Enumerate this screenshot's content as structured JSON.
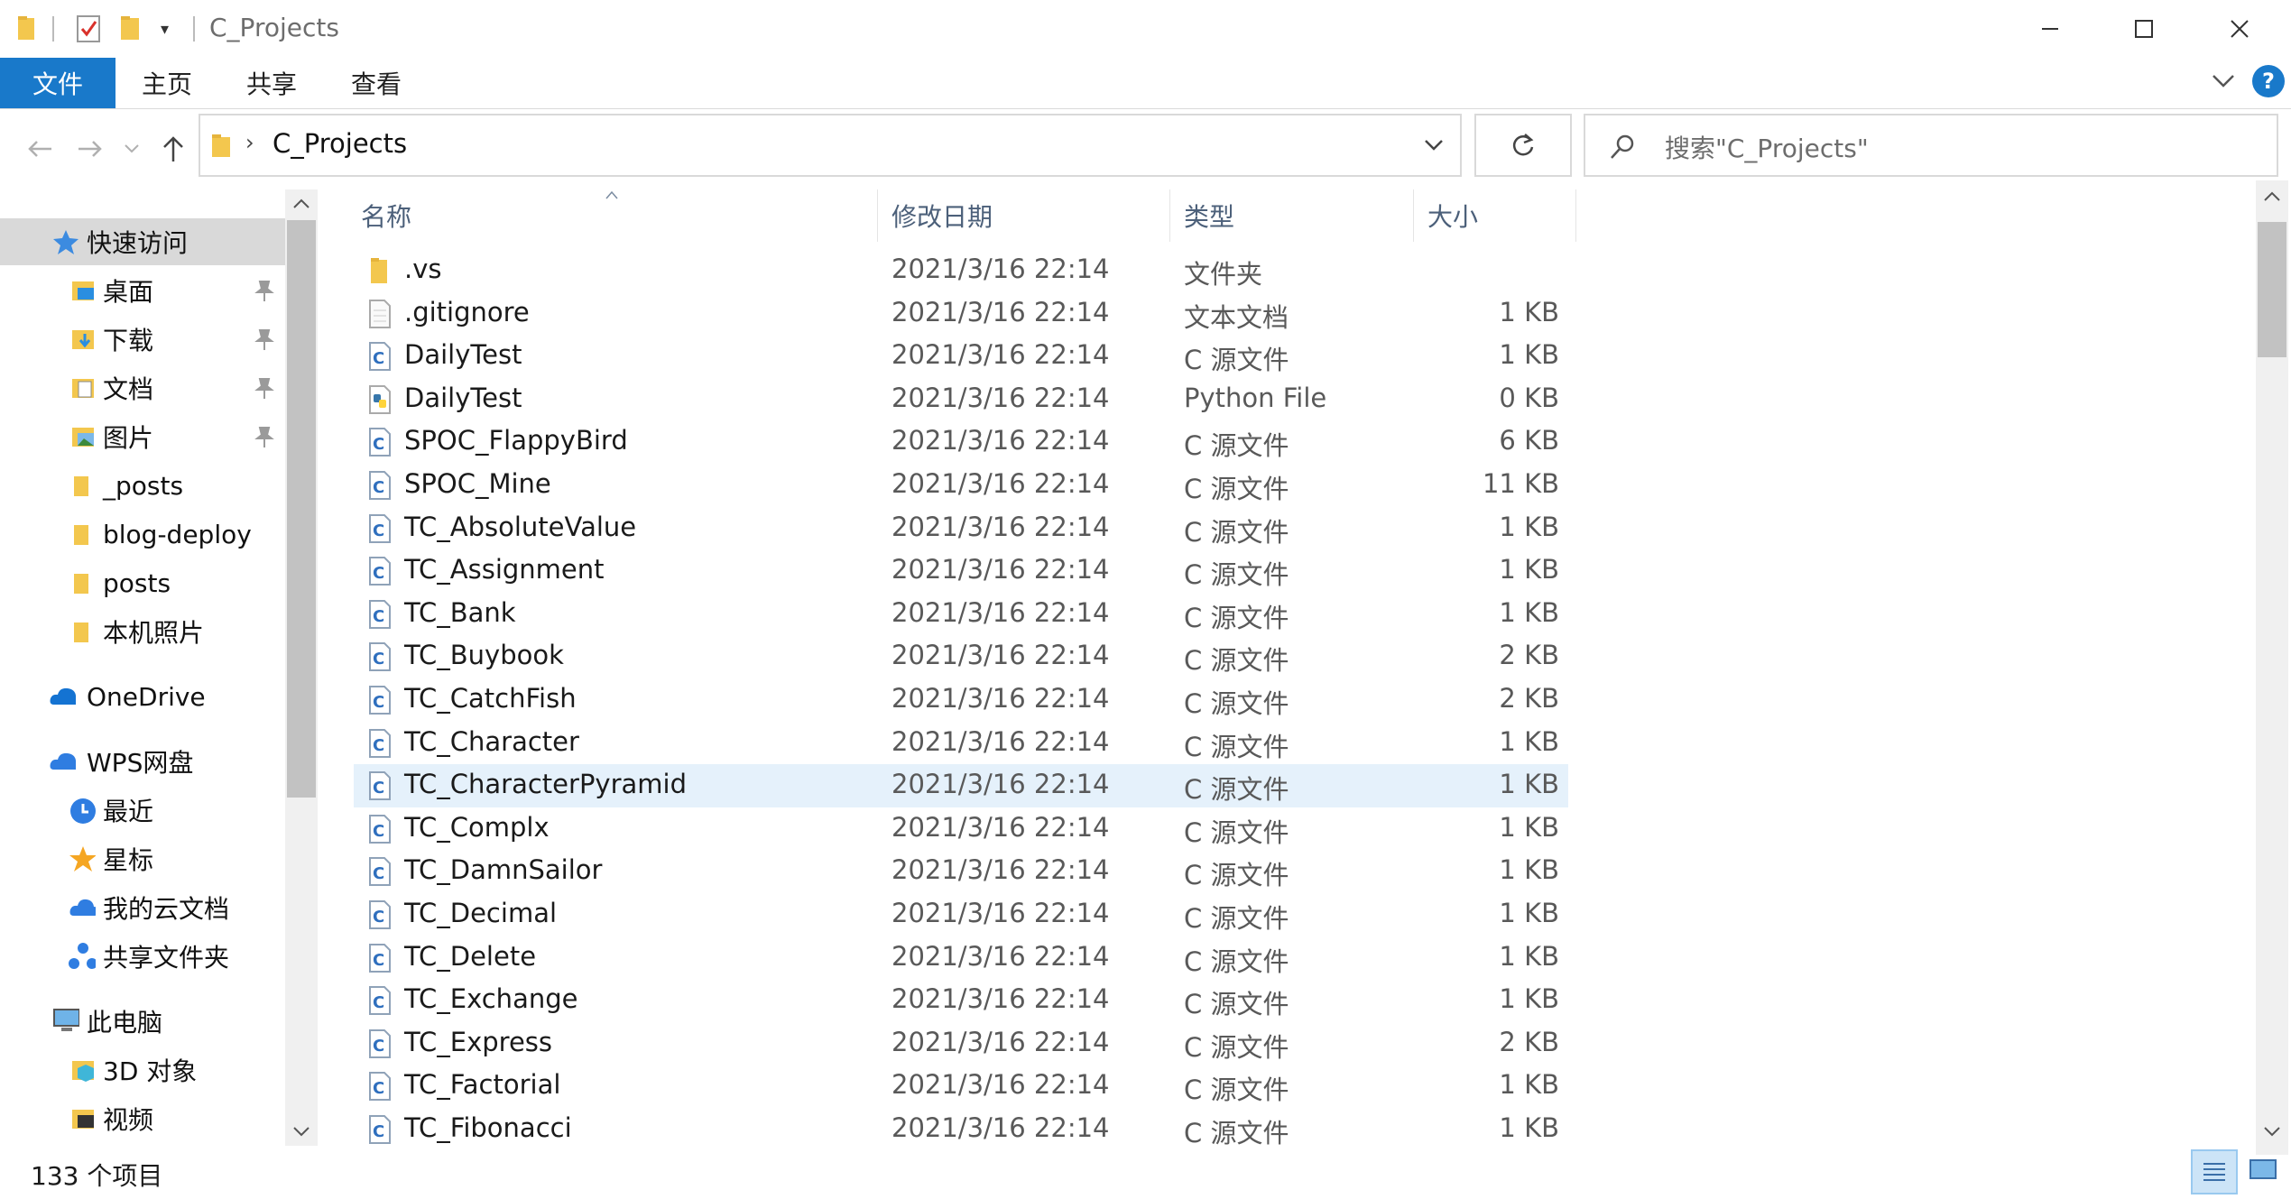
{
  "window": {
    "title": "C_Projects",
    "controls": [
      "minimize",
      "maximize",
      "close"
    ]
  },
  "ribbon": {
    "tabs": [
      "文件",
      "主页",
      "共享",
      "查看"
    ]
  },
  "address": {
    "current_folder": "C_Projects",
    "search_placeholder": "搜索\"C_Projects\""
  },
  "nav": {
    "quick_access": "快速访问",
    "pinned": [
      "桌面",
      "下载",
      "文档",
      "图片"
    ],
    "folders": [
      "_posts",
      "blog-deploy",
      "posts",
      "本机照片"
    ],
    "onedrive": "OneDrive",
    "wps": "WPS网盘",
    "wps_items": [
      "最近",
      "星标",
      "我的云文档",
      "共享文件夹"
    ],
    "this_pc": "此电脑",
    "pc_items": [
      "3D 对象",
      "视频"
    ]
  },
  "columns": [
    "名称",
    "修改日期",
    "类型",
    "大小"
  ],
  "files": [
    {
      "name": ".vs",
      "date": "2021/3/16 22:14",
      "type": "文件夹",
      "size": "",
      "icon": "folder"
    },
    {
      "name": ".gitignore",
      "date": "2021/3/16 22:14",
      "type": "文本文档",
      "size": "1 KB",
      "icon": "text"
    },
    {
      "name": "DailyTest",
      "date": "2021/3/16 22:14",
      "type": "C 源文件",
      "size": "1 KB",
      "icon": "c"
    },
    {
      "name": "DailyTest",
      "date": "2021/3/16 22:14",
      "type": "Python File",
      "size": "0 KB",
      "icon": "python"
    },
    {
      "name": "SPOC_FlappyBird",
      "date": "2021/3/16 22:14",
      "type": "C 源文件",
      "size": "6 KB",
      "icon": "c"
    },
    {
      "name": "SPOC_Mine",
      "date": "2021/3/16 22:14",
      "type": "C 源文件",
      "size": "11 KB",
      "icon": "c"
    },
    {
      "name": "TC_AbsoluteValue",
      "date": "2021/3/16 22:14",
      "type": "C 源文件",
      "size": "1 KB",
      "icon": "c"
    },
    {
      "name": "TC_Assignment",
      "date": "2021/3/16 22:14",
      "type": "C 源文件",
      "size": "1 KB",
      "icon": "c"
    },
    {
      "name": "TC_Bank",
      "date": "2021/3/16 22:14",
      "type": "C 源文件",
      "size": "1 KB",
      "icon": "c"
    },
    {
      "name": "TC_Buybook",
      "date": "2021/3/16 22:14",
      "type": "C 源文件",
      "size": "2 KB",
      "icon": "c"
    },
    {
      "name": "TC_CatchFish",
      "date": "2021/3/16 22:14",
      "type": "C 源文件",
      "size": "2 KB",
      "icon": "c"
    },
    {
      "name": "TC_Character",
      "date": "2021/3/16 22:14",
      "type": "C 源文件",
      "size": "1 KB",
      "icon": "c"
    },
    {
      "name": "TC_CharacterPyramid",
      "date": "2021/3/16 22:14",
      "type": "C 源文件",
      "size": "1 KB",
      "icon": "c",
      "selected": true
    },
    {
      "name": "TC_Complx",
      "date": "2021/3/16 22:14",
      "type": "C 源文件",
      "size": "1 KB",
      "icon": "c"
    },
    {
      "name": "TC_DamnSailor",
      "date": "2021/3/16 22:14",
      "type": "C 源文件",
      "size": "1 KB",
      "icon": "c"
    },
    {
      "name": "TC_Decimal",
      "date": "2021/3/16 22:14",
      "type": "C 源文件",
      "size": "1 KB",
      "icon": "c"
    },
    {
      "name": "TC_Delete",
      "date": "2021/3/16 22:14",
      "type": "C 源文件",
      "size": "1 KB",
      "icon": "c"
    },
    {
      "name": "TC_Exchange",
      "date": "2021/3/16 22:14",
      "type": "C 源文件",
      "size": "1 KB",
      "icon": "c"
    },
    {
      "name": "TC_Express",
      "date": "2021/3/16 22:14",
      "type": "C 源文件",
      "size": "2 KB",
      "icon": "c"
    },
    {
      "name": "TC_Factorial",
      "date": "2021/3/16 22:14",
      "type": "C 源文件",
      "size": "1 KB",
      "icon": "c"
    },
    {
      "name": "TC_Fibonacci",
      "date": "2021/3/16 22:14",
      "type": "C 源文件",
      "size": "1 KB",
      "icon": "c"
    }
  ],
  "status": {
    "item_count": "133 个项目"
  },
  "colors": {
    "accent": "#1979ca",
    "selection": "#e5f1fb",
    "folder": "#f8d775",
    "header_text": "#4c607a"
  }
}
